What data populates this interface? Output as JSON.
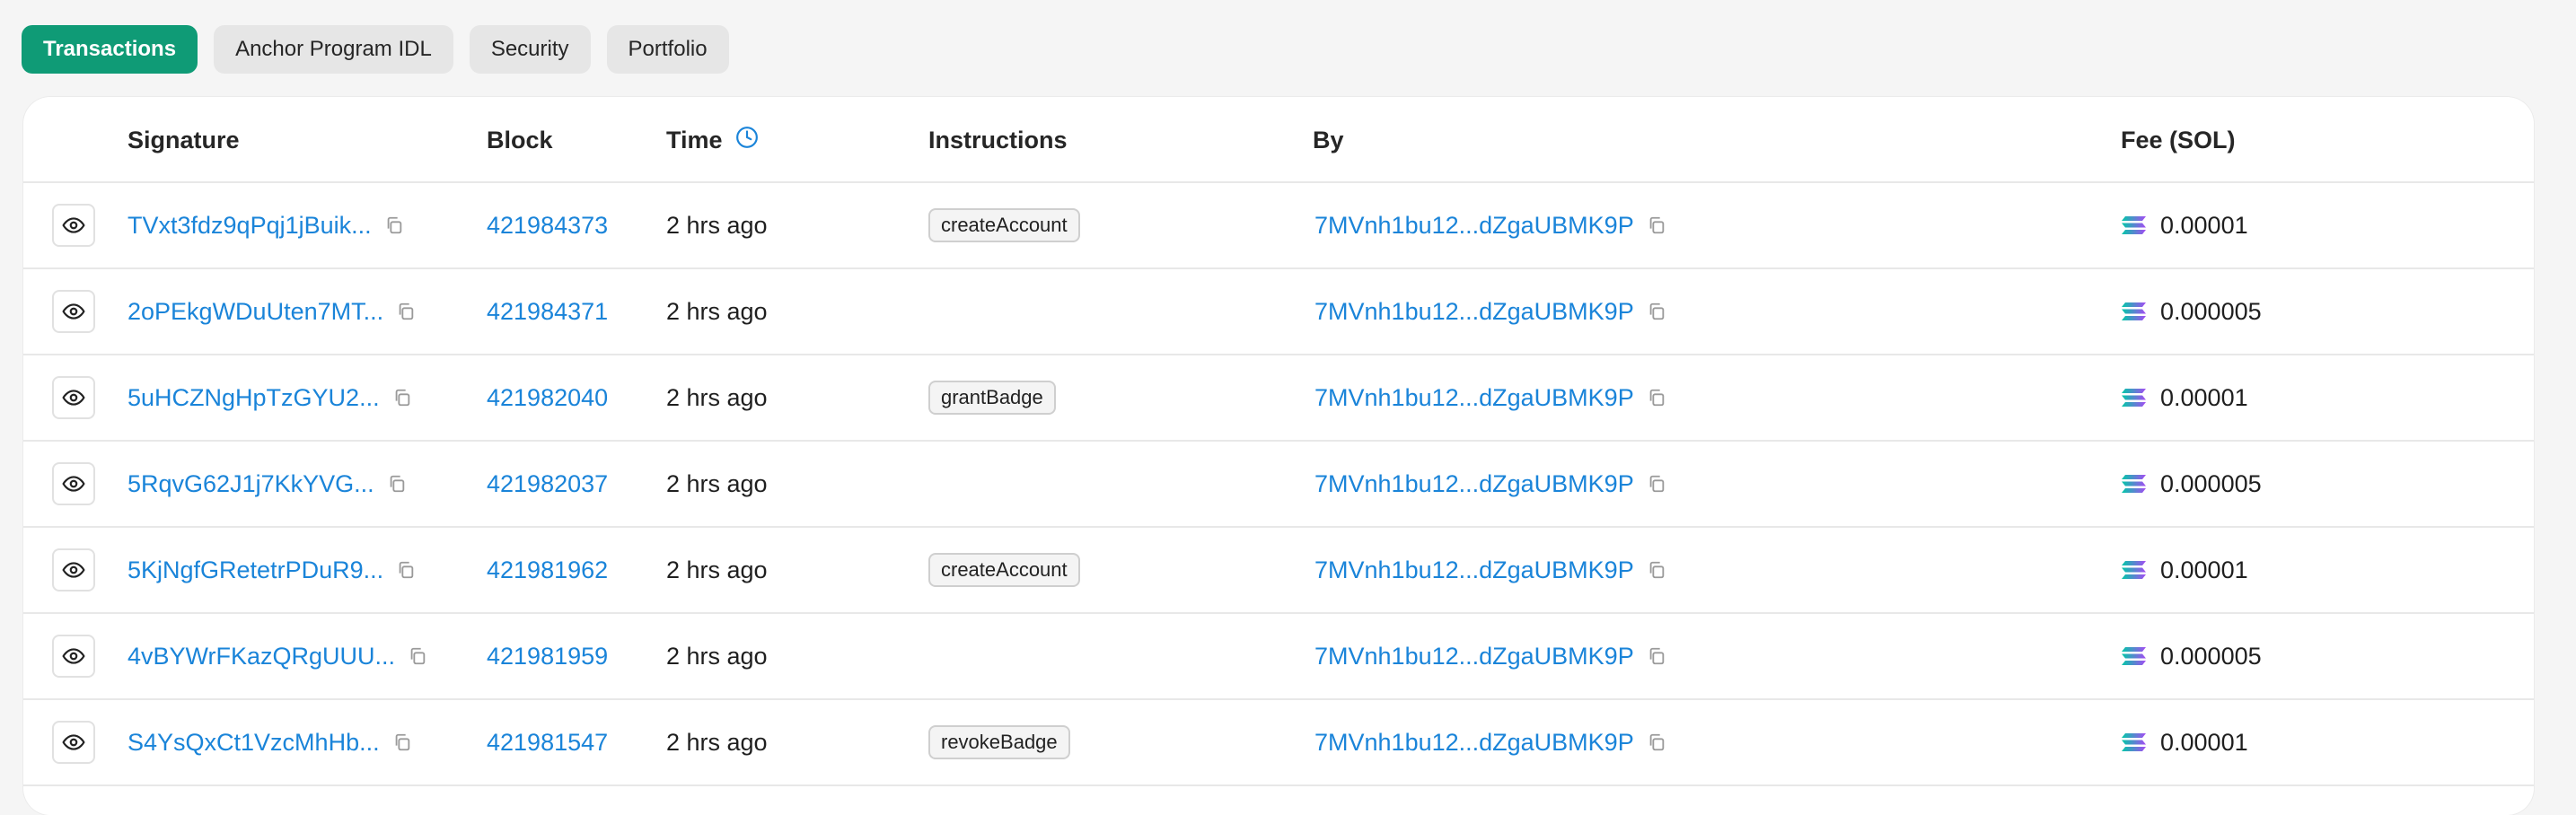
{
  "tabs": [
    {
      "label": "Transactions",
      "active": true
    },
    {
      "label": "Anchor Program IDL",
      "active": false
    },
    {
      "label": "Security",
      "active": false
    },
    {
      "label": "Portfolio",
      "active": false
    }
  ],
  "table": {
    "columns": {
      "signature": "Signature",
      "block": "Block",
      "time": "Time",
      "instructions": "Instructions",
      "by": "By",
      "fee": "Fee (SOL)"
    },
    "rows": [
      {
        "signature": "TVxt3fdz9qPqj1jBuik...",
        "block": "421984373",
        "time": "2 hrs ago",
        "instruction": "createAccount",
        "by": "7MVnh1bu12...dZgaUBMK9P",
        "fee": "0.00001"
      },
      {
        "signature": "2oPEkgWDuUten7MT...",
        "block": "421984371",
        "time": "2 hrs ago",
        "instruction": "",
        "by": "7MVnh1bu12...dZgaUBMK9P",
        "fee": "0.000005"
      },
      {
        "signature": "5uHCZNgHpTzGYU2...",
        "block": "421982040",
        "time": "2 hrs ago",
        "instruction": "grantBadge",
        "by": "7MVnh1bu12...dZgaUBMK9P",
        "fee": "0.00001"
      },
      {
        "signature": "5RqvG62J1j7KkYVG...",
        "block": "421982037",
        "time": "2 hrs ago",
        "instruction": "",
        "by": "7MVnh1bu12...dZgaUBMK9P",
        "fee": "0.000005"
      },
      {
        "signature": "5KjNgfGRetetrPDuR9...",
        "block": "421981962",
        "time": "2 hrs ago",
        "instruction": "createAccount",
        "by": "7MVnh1bu12...dZgaUBMK9P",
        "fee": "0.00001"
      },
      {
        "signature": "4vBYWrFKazQRgUUU...",
        "block": "421981959",
        "time": "2 hrs ago",
        "instruction": "",
        "by": "7MVnh1bu12...dZgaUBMK9P",
        "fee": "0.000005"
      },
      {
        "signature": "S4YsQxCt1VzcMhHb...",
        "block": "421981547",
        "time": "2 hrs ago",
        "instruction": "revokeBadge",
        "by": "7MVnh1bu12...dZgaUBMK9P",
        "fee": "0.00001"
      }
    ]
  },
  "icons": {
    "view": "eye-icon",
    "copy": "copy-icon",
    "time": "clock-icon",
    "fee": "solana-icon"
  },
  "colors": {
    "accent": "#0f9b76",
    "link": "#1a84d9"
  }
}
